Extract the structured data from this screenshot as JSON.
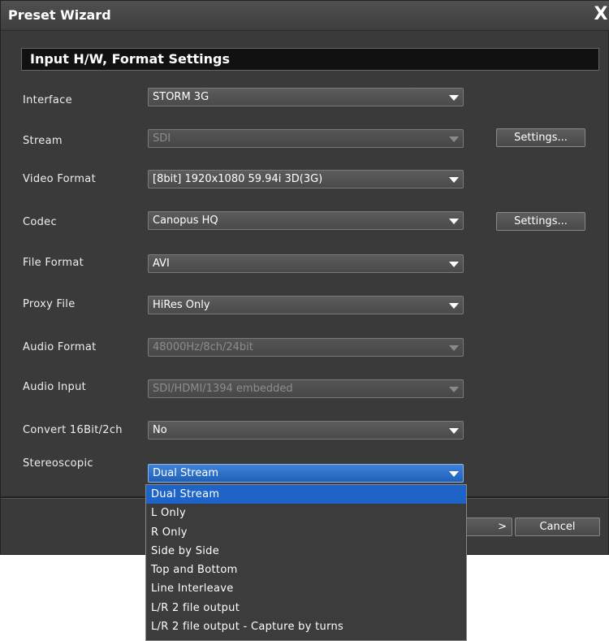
{
  "window": {
    "title": "Preset Wizard",
    "close_glyph": "X"
  },
  "section": {
    "title": "Input H/W, Format Settings"
  },
  "rows": [
    {
      "label": "Interface",
      "value": "STORM 3G",
      "disabled": false
    },
    {
      "label": "Stream",
      "value": "SDI",
      "disabled": true
    },
    {
      "label": "Video Format",
      "value": "[8bit] 1920x1080 59.94i 3D(3G)",
      "disabled": false
    },
    {
      "label": "Codec",
      "value": "Canopus HQ",
      "disabled": false
    },
    {
      "label": "File Format",
      "value": "AVI",
      "disabled": false
    },
    {
      "label": "Proxy File",
      "value": "HiRes Only",
      "disabled": false
    },
    {
      "label": "Audio Format",
      "value": "48000Hz/8ch/24bit",
      "disabled": true
    },
    {
      "label": "Audio Input",
      "value": "SDI/HDMI/1394 embedded",
      "disabled": true
    },
    {
      "label": "Convert 16Bit/2ch",
      "value": "No",
      "disabled": false
    },
    {
      "label": "Stereoscopic",
      "value": "Dual Stream",
      "disabled": false
    }
  ],
  "buttons": {
    "stream_settings": "Settings...",
    "codec_settings": "Settings...",
    "next_fragment": ">",
    "cancel": "Cancel"
  },
  "dropdown": {
    "selected_index": 0,
    "options": [
      "Dual Stream",
      "L Only",
      "R Only",
      "Side by Side",
      "Top and Bottom",
      "Line Interleave",
      "L/R 2 file output",
      "L/R 2 file output - Capture by turns"
    ]
  },
  "colors": {
    "accent": "#1e64c8",
    "dialog_bg": "#3a3a3a"
  }
}
